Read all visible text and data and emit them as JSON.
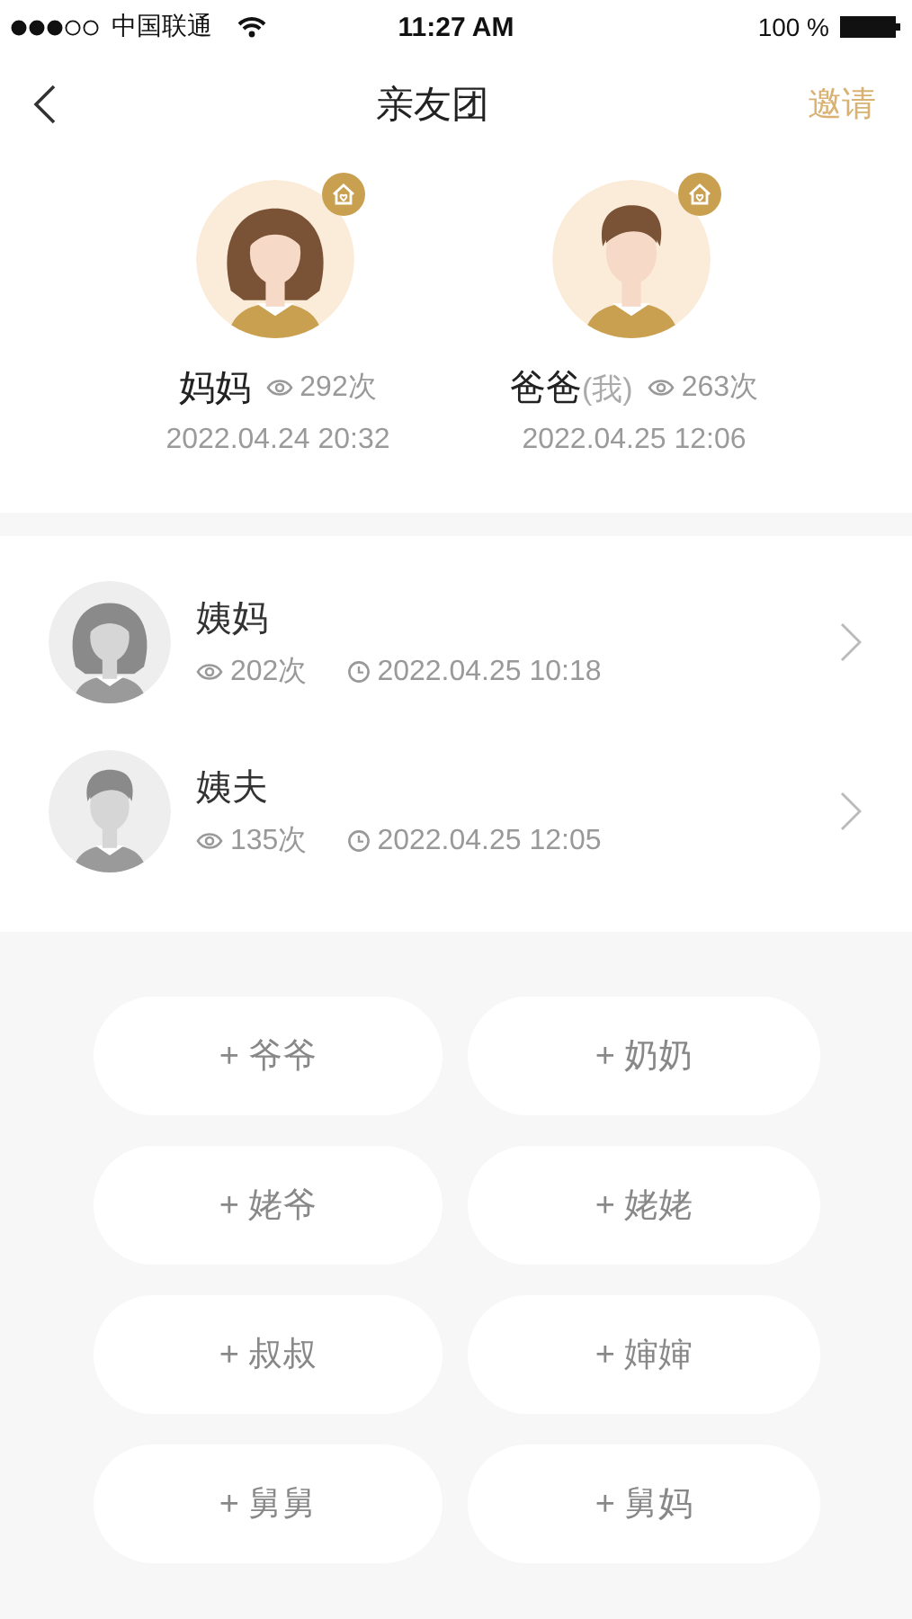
{
  "status_bar": {
    "carrier": "中国联通",
    "time": "11:27 AM",
    "battery": "100 %"
  },
  "nav": {
    "title": "亲友团",
    "action": "邀请"
  },
  "featured": [
    {
      "kind": "female",
      "name": "妈妈",
      "views": "292次",
      "time": "2022.04.24 20:32"
    },
    {
      "kind": "male",
      "name": "爸爸",
      "me_tag": "(我)",
      "views": "263次",
      "time": "2022.04.25 12:06"
    }
  ],
  "members": [
    {
      "kind": "female",
      "name": "姨妈",
      "views": "202次",
      "time": "2022.04.25 10:18"
    },
    {
      "kind": "male",
      "name": "姨夫",
      "views": "135次",
      "time": "2022.04.25 12:05"
    }
  ],
  "add_buttons": [
    "+ 爷爷",
    "+ 奶奶",
    "+ 姥爷",
    "+ 姥姥",
    "+ 叔叔",
    "+ 婶婶",
    "+ 舅舅",
    "+ 舅妈"
  ]
}
